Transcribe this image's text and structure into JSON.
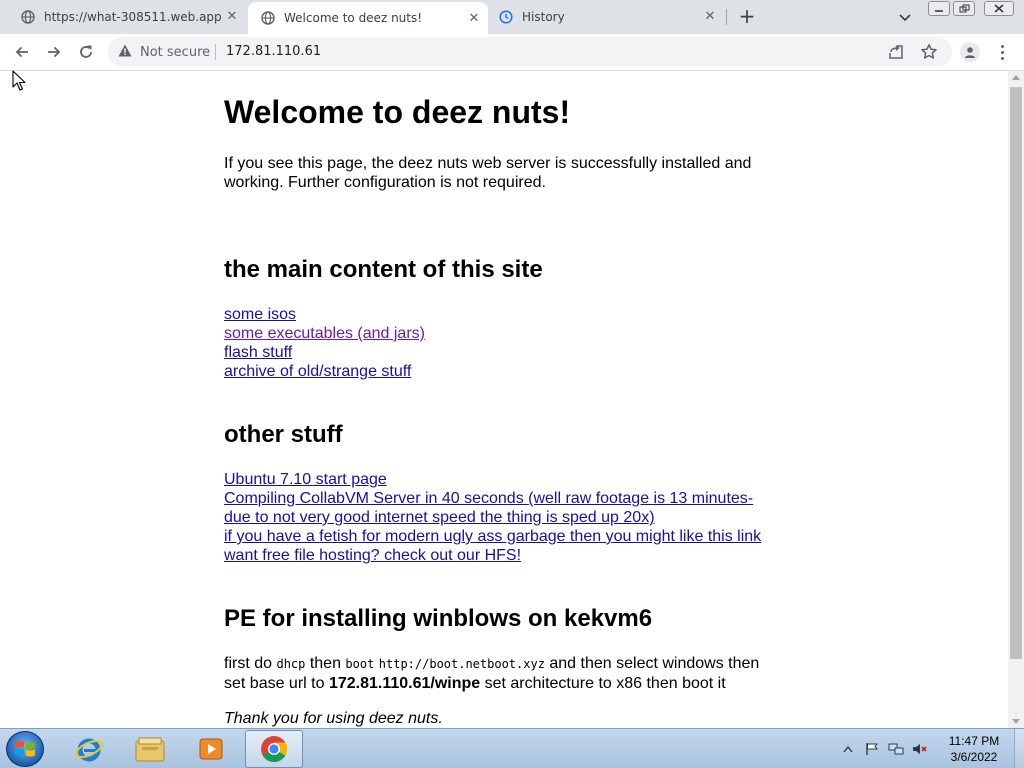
{
  "browser": {
    "tabs": [
      {
        "title": "https://what-308511.web.app",
        "active": false
      },
      {
        "title": "Welcome to deez nuts!",
        "active": true
      },
      {
        "title": "History",
        "active": false
      }
    ],
    "address_bar": {
      "security_label": "Not secure",
      "url": "172.81.110.61"
    }
  },
  "page": {
    "title": "Welcome to deez nuts!",
    "intro": "If you see this page, the deez nuts web server is successfully installed and working. Further configuration is not required.",
    "main_section": {
      "heading": "the main content of this site",
      "links": [
        {
          "label": "some isos",
          "visited": false
        },
        {
          "label": "some executables (and jars)",
          "visited": true
        },
        {
          "label": "flash stuff",
          "visited": false
        },
        {
          "label": "archive of old/strange stuff",
          "visited": false
        }
      ]
    },
    "other_section": {
      "heading": "other stuff",
      "links": [
        {
          "label": "Ubuntu 7.10 start page"
        },
        {
          "label": "Compiling CollabVM Server in 40 seconds (well raw footage is 13 minutes- due to not very good internet speed the thing is sped up 20x)"
        },
        {
          "label": "if you have a fetish for modern ugly ass garbage then you might like this link"
        },
        {
          "label": "want free file hosting? check out our HFS!"
        }
      ]
    },
    "pe_section": {
      "heading": "PE for installing winblows on kekvm6",
      "text_1": "first do ",
      "code_1": "dhcp",
      "text_2": " then ",
      "code_2": "boot",
      "text_3": " ",
      "code_3": "http://boot.netboot.xyz",
      "text_4": " and then select windows then set base url to ",
      "bold_url": "172.81.110.61/winpe",
      "text_5": " set architecture to x86 then boot it"
    },
    "footer": "Thank you for using deez nuts."
  },
  "taskbar": {
    "clock_time": "11:47 PM",
    "clock_date": "3/6/2022",
    "apps": [
      "start-button",
      "internet-explorer",
      "file-explorer",
      "media-player",
      "chrome"
    ]
  },
  "colors": {
    "link": "#1a0dab",
    "link_visited": "#681da8",
    "tabstrip_bg": "#dee1e6",
    "omnibox_bg": "#f1f3f4"
  }
}
